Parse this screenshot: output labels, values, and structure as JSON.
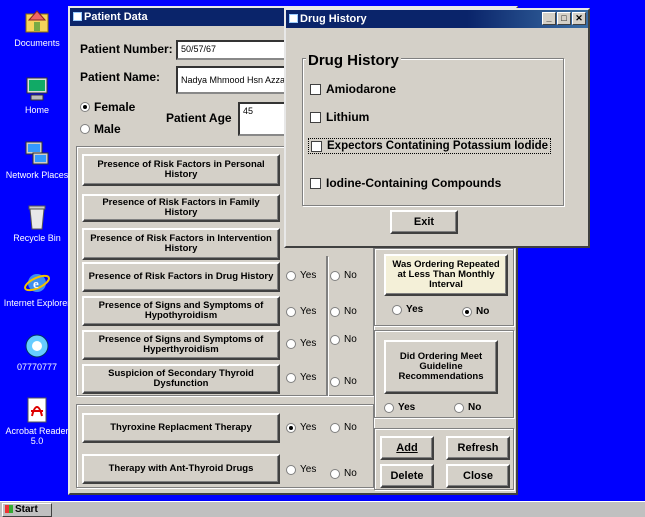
{
  "desktop": {
    "icons": [
      {
        "label": "Documents"
      },
      {
        "label": "Home"
      },
      {
        "label": "Network Places"
      },
      {
        "label": "Recycle Bin"
      },
      {
        "label": "Internet Explorer"
      },
      {
        "label": "07770777"
      },
      {
        "label": "Acrobat Reader 5.0"
      }
    ]
  },
  "taskbar": {
    "start_label": "Start"
  },
  "patient": {
    "title": "Patient Data",
    "number_label": "Patient Number:",
    "number_value": "50/57/67",
    "name_label": "Patient Name:",
    "name_value": "Nadya Mhmood Hsn Azzaz",
    "female": "Female",
    "male": "Male",
    "age_label": "Patient Age",
    "age_value": "45",
    "risk_buttons": [
      "Presence of Risk Factors in Personal History",
      "Presence of Risk Factors in Family History",
      "Presence of Risk Factors in Intervention History",
      "Presence of Risk Factors in Drug History",
      "Presence of Signs and Symptoms of Hypothyroidism",
      "Presence of Signs and Symptoms of Hyperthyroidism",
      "Suspicion of Secondary Thyroid Dysfunction"
    ],
    "therapy_buttons": [
      "Thyroxine Replacment Therapy",
      "Therapy  with Ant-Thyroid Drugs"
    ],
    "yes": "Yes",
    "no": "No",
    "ordering_repeated": "Was Ordering Repeated at Less Than Monthly Interval",
    "ordering_guideline": "Did Ordering Meet Guideline Recommendations",
    "add": "Add",
    "refresh": "Refresh",
    "delete": "Delete",
    "close": "Close"
  },
  "drug": {
    "title": "Drug History",
    "heading": "Drug History",
    "items": [
      "Amiodarone",
      "Lithium",
      "Expectors Contatining Potassium Iodide",
      "Iodine-Containing Compounds"
    ],
    "exit": "Exit"
  }
}
